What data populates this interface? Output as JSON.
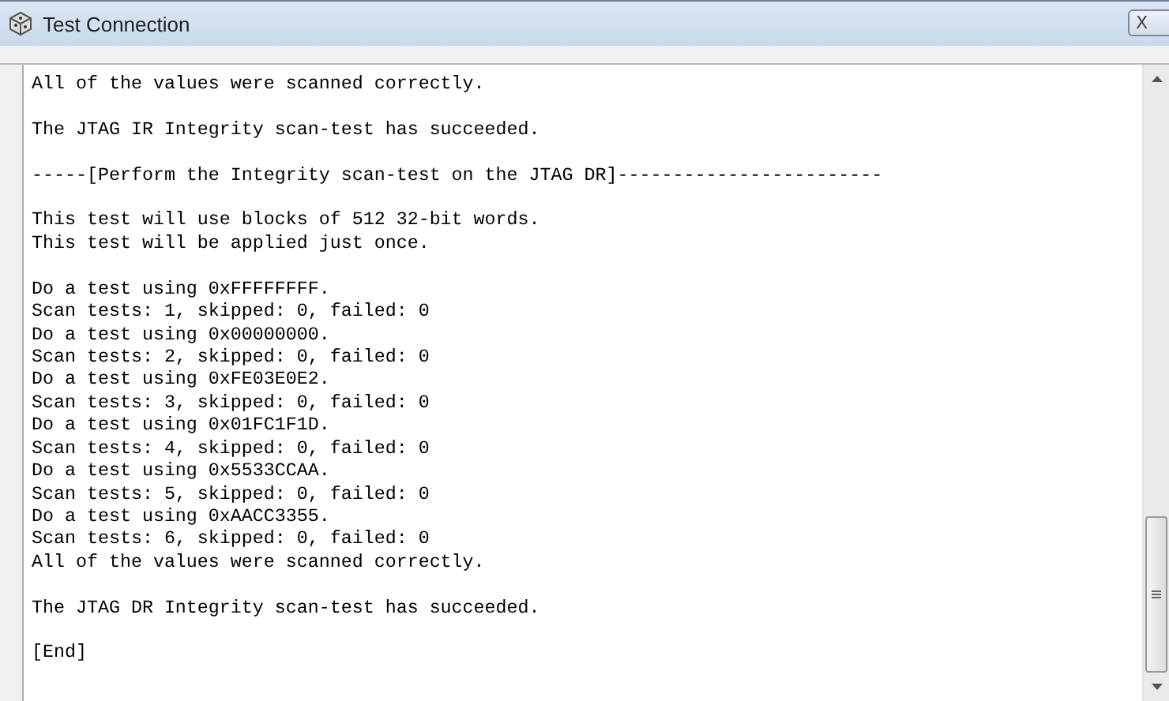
{
  "window": {
    "title": "Test Connection",
    "close_glyph": "X"
  },
  "output": {
    "blocks": [
      {
        "lines": [
          "All of the values were scanned correctly."
        ]
      },
      {
        "lines": [
          "The JTAG IR Integrity scan-test has succeeded."
        ]
      },
      {
        "lines": [
          "-----[Perform the Integrity scan-test on the JTAG DR]------------------------"
        ]
      },
      {
        "lines": [
          "This test will use blocks of 512 32-bit words.",
          "This test will be applied just once."
        ]
      },
      {
        "lines": [
          "Do a test using 0xFFFFFFFF.",
          "Scan tests: 1, skipped: 0, failed: 0",
          "Do a test using 0x00000000.",
          "Scan tests: 2, skipped: 0, failed: 0",
          "Do a test using 0xFE03E0E2.",
          "Scan tests: 3, skipped: 0, failed: 0",
          "Do a test using 0x01FC1F1D.",
          "Scan tests: 4, skipped: 0, failed: 0",
          "Do a test using 0x5533CCAA.",
          "Scan tests: 5, skipped: 0, failed: 0",
          "Do a test using 0xAACC3355.",
          "Scan tests: 6, skipped: 0, failed: 0",
          "All of the values were scanned correctly."
        ]
      },
      {
        "lines": [
          "The JTAG DR Integrity scan-test has succeeded."
        ]
      },
      {
        "lines": [
          "[End]"
        ]
      }
    ]
  }
}
